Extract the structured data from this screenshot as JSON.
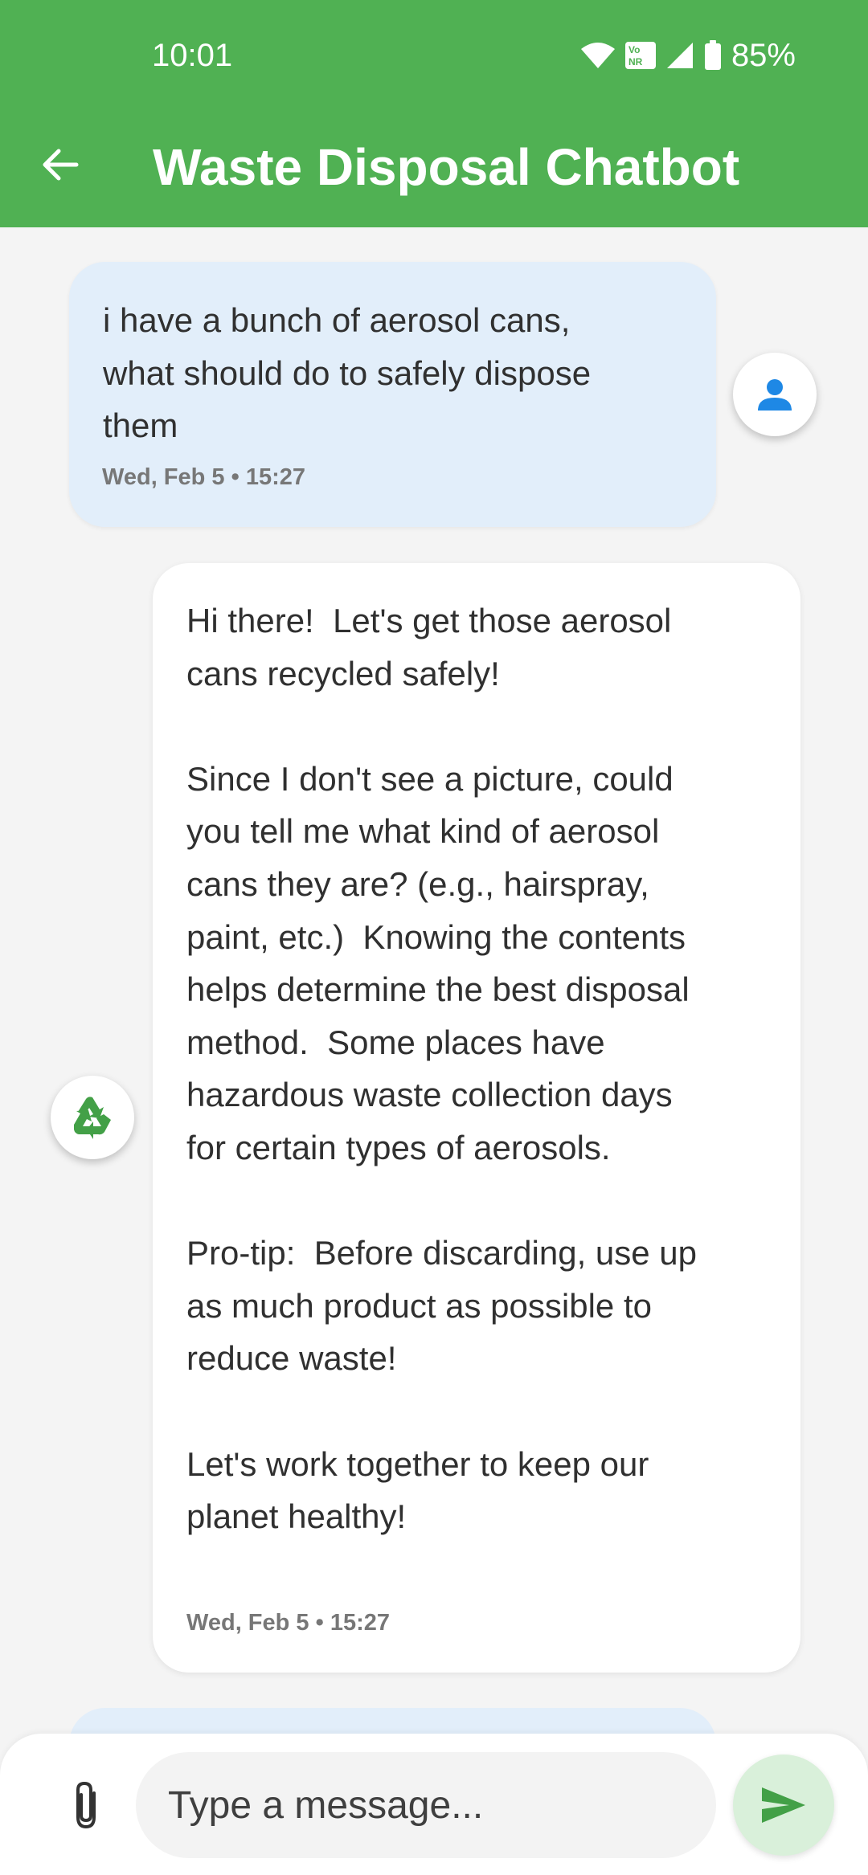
{
  "status_bar": {
    "time": "10:01",
    "battery": "85%",
    "vonr_label": "Vo NR"
  },
  "header": {
    "title": "Waste Disposal Chatbot",
    "back_icon": "arrow-back-icon",
    "color": "#50b153"
  },
  "messages": [
    {
      "sender": "user",
      "text": "i have a bunch of aerosol cans,\nwhat should do to safely dispose\nthem",
      "timestamp": "Wed, Feb 5 • 15:27",
      "avatar_icon": "person-icon"
    },
    {
      "sender": "bot",
      "text": "Hi there!  Let's get those aerosol\ncans recycled safely!\n\nSince I don't see a picture, could\nyou tell me what kind of aerosol\ncans they are? (e.g., hairspray,\npaint, etc.)  Knowing the contents\nhelps determine the best disposal\nmethod.  Some places have\nhazardous waste collection days\nfor certain types of aerosols.\n\nPro-tip:  Before discarding, use up\nas much product as possible to\nreduce waste!\n\nLet's work together to keep our\nplanet healthy!",
      "timestamp": "Wed, Feb 5 • 15:27",
      "avatar_icon": "recycle-icon"
    }
  ],
  "composer": {
    "placeholder": "Type a message...",
    "value": "",
    "attach_icon": "paperclip-icon",
    "send_icon": "send-icon"
  },
  "colors": {
    "user_bubble": "#e2eefa",
    "bot_bubble": "#ffffff",
    "accent": "#50b153",
    "user_avatar_icon": "#1e88e5"
  }
}
